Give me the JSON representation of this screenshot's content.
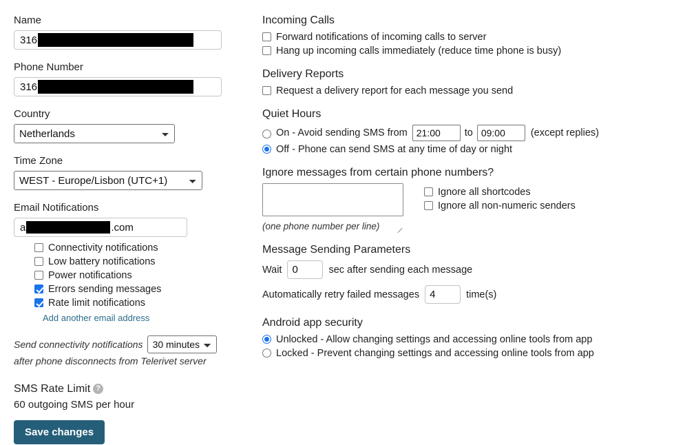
{
  "left": {
    "name": {
      "label": "Name",
      "value_prefix": "316",
      "redacted": true
    },
    "phone": {
      "label": "Phone Number",
      "value_prefix": "316",
      "redacted": true
    },
    "country": {
      "label": "Country",
      "selected": "Netherlands"
    },
    "timezone": {
      "label": "Time Zone",
      "selected": "WEST - Europe/Lisbon (UTC+1)"
    },
    "email": {
      "label": "Email Notifications",
      "value_prefix": "a",
      "value_suffix": ".com",
      "redacted": true,
      "options": [
        {
          "label": "Connectivity notifications",
          "checked": false
        },
        {
          "label": "Low battery notifications",
          "checked": false
        },
        {
          "label": "Power notifications",
          "checked": false
        },
        {
          "label": "Errors sending messages",
          "checked": true
        },
        {
          "label": "Rate limit notifications",
          "checked": true
        }
      ],
      "add_link": "Add another email address"
    },
    "connectivity": {
      "prefix": "Send connectivity notifications",
      "delay_selected": "30 minutes",
      "suffix": "after phone disconnects from Telerivet server"
    },
    "rate_limit": {
      "title": "SMS Rate Limit",
      "help_icon": "question-mark-icon",
      "value": "60 outgoing SMS per hour"
    },
    "save_label": "Save changes"
  },
  "right": {
    "incoming_calls": {
      "title": "Incoming Calls",
      "options": [
        {
          "label": "Forward notifications of incoming calls to server",
          "checked": false
        },
        {
          "label": "Hang up incoming calls immediately (reduce time phone is busy)",
          "checked": false
        }
      ]
    },
    "delivery_reports": {
      "title": "Delivery Reports",
      "options": [
        {
          "label": "Request a delivery report for each message you send",
          "checked": false
        }
      ]
    },
    "quiet_hours": {
      "title": "Quiet Hours",
      "on_label_a": "On - Avoid sending SMS from",
      "on_label_to": "to",
      "from_time": "21:00",
      "to_time": "09:00",
      "except": "(except replies)",
      "off_label": "Off - Phone can send SMS at any time of day or night",
      "selected": "off"
    },
    "ignore": {
      "title": "Ignore messages from certain phone numbers?",
      "textarea_value": "",
      "hint": "(one phone number per line)",
      "options": [
        {
          "label": "Ignore all shortcodes",
          "checked": false
        },
        {
          "label": "Ignore all non-numeric senders",
          "checked": false
        }
      ]
    },
    "sending": {
      "title": "Message Sending Parameters",
      "wait_prefix": "Wait",
      "wait_value": "0",
      "wait_suffix": "sec after sending each message",
      "retry_prefix": "Automatically retry failed messages",
      "retry_value": "4",
      "retry_suffix": "time(s)"
    },
    "security": {
      "title": "Android app security",
      "unlocked_label": "Unlocked - Allow changing settings and accessing online tools from app",
      "locked_label": "Locked - Prevent changing settings and accessing online tools from app",
      "selected": "unlocked"
    }
  },
  "colors": {
    "accent": "#1a73e8",
    "button": "#255e79",
    "link": "#2a6b8a"
  }
}
